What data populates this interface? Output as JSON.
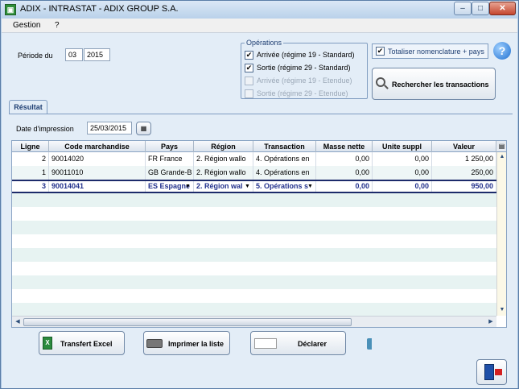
{
  "window": {
    "title": "ADIX - INTRASTAT - ADIX GROUP S.A.",
    "minimize": "–",
    "maximize": "□",
    "close": "✕"
  },
  "menu": {
    "gestion": "Gestion",
    "help": "?"
  },
  "periode": {
    "label": "Période du",
    "month": "03",
    "year": "2015"
  },
  "operations": {
    "title": "Opérations",
    "items": [
      {
        "label": "Arrivée (régime 19 - Standard)",
        "checked": true,
        "enabled": true
      },
      {
        "label": "Sortie (régime 29 - Standard)",
        "checked": true,
        "enabled": true
      },
      {
        "label": "Arrivée (régime 19 - Etendue)",
        "checked": false,
        "enabled": false
      },
      {
        "label": "Sortie (régime 29 - Etendue)",
        "checked": false,
        "enabled": false
      }
    ]
  },
  "totaliser": {
    "label": "Totaliser nomenclature + pays",
    "checked": true
  },
  "search_button": "Rechercher les transactions",
  "tab": "Résultat",
  "date_impression": {
    "label": "Date d'impression",
    "value": "25/03/2015"
  },
  "grid": {
    "columns": [
      "Ligne",
      "Code marchandise",
      "Pays",
      "Région",
      "Transaction",
      "Masse nette",
      "Unite suppl",
      "Valeur"
    ],
    "rows": [
      {
        "ligne": "2",
        "code": "90014020",
        "pays": "FR France",
        "region": "2. Région wallo",
        "transaction": "4. Opérations en",
        "masse": "0,00",
        "unite": "0,00",
        "valeur": "1 250,00"
      },
      {
        "ligne": "1",
        "code": "90011010",
        "pays": "GB Grande-B",
        "region": "2. Région wallo",
        "transaction": "4. Opérations en",
        "masse": "0,00",
        "unite": "0,00",
        "valeur": "250,00"
      },
      {
        "ligne": "3",
        "code": "90014041",
        "pays": "ES Espagne",
        "region": "2. Région wal",
        "transaction": "5. Opérations s",
        "masse": "0,00",
        "unite": "0,00",
        "valeur": "950,00"
      }
    ]
  },
  "buttons": {
    "excel": "Transfert Excel",
    "print": "Imprimer la liste",
    "declare": "Déclarer"
  },
  "icons": {
    "help": "help-icon",
    "search": "magnifier-icon",
    "excel": "excel-icon",
    "print": "printer-icon",
    "exit": "exit-door-icon"
  }
}
